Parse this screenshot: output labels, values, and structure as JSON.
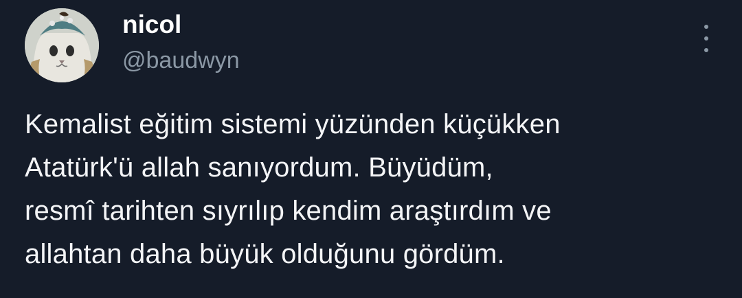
{
  "tweet": {
    "author": {
      "display_name": "nicol",
      "handle": "@baudwyn",
      "avatar_icon": "cat-avatar-icon"
    },
    "more_icon": "more-options-icon",
    "text": "Kemalist eğitim sistemi yüzünden küçükken\nAtatürk'ü allah sanıyordum. Büyüdüm,\nresmî tarihten sıyrılıp kendim araştırdım ve\nallahtan daha büyük olduğunu gördüm."
  },
  "colors": {
    "background": "#151c29",
    "name": "#ffffff",
    "handle": "#8b98a5",
    "body_text": "#f3f4f6"
  }
}
